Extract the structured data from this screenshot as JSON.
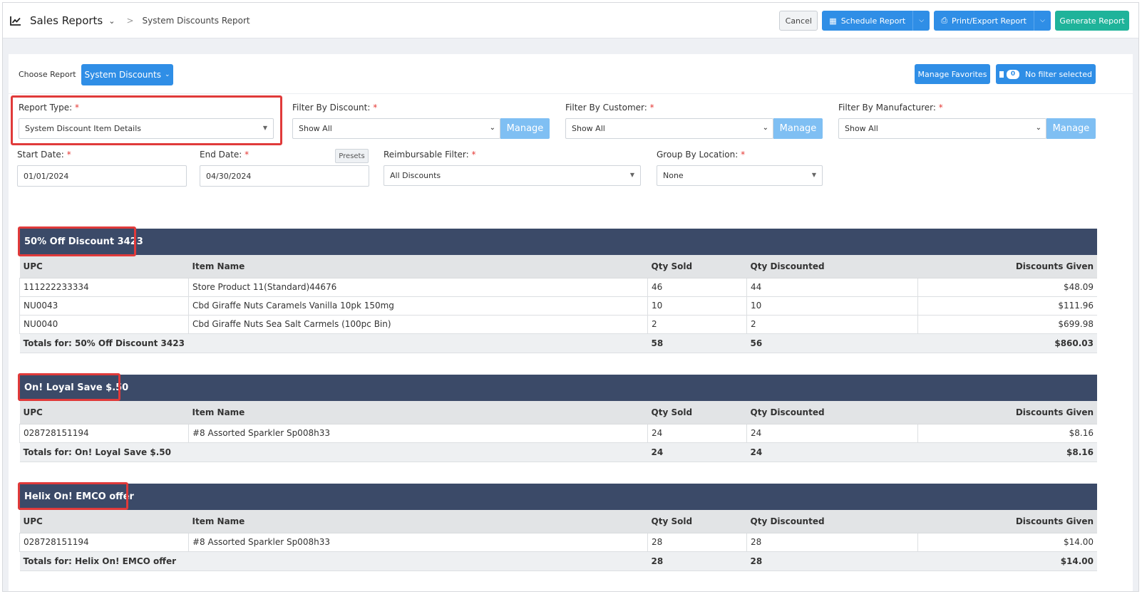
{
  "header": {
    "title": "Sales Reports",
    "breadcrumb": "System Discounts Report",
    "cancel_label": "Cancel",
    "schedule_label": "Schedule Report",
    "print_label": "Print/Export Report",
    "generate_label": "Generate Report"
  },
  "choose": {
    "label": "Choose Report",
    "selected": "System Discounts",
    "manage_favorites": "Manage Favorites",
    "filter_count": "0",
    "filter_text": "No filter selected"
  },
  "filters": {
    "report_type": {
      "label": "Report Type:",
      "value": "System Discount Item Details"
    },
    "discount": {
      "label": "Filter By Discount:",
      "value": "Show All",
      "manage": "Manage"
    },
    "customer": {
      "label": "Filter By Customer:",
      "value": "Show All",
      "manage": "Manage"
    },
    "manufacturer": {
      "label": "Filter By Manufacturer:",
      "value": "Show All",
      "manage": "Manage"
    },
    "start_date": {
      "label": "Start Date:",
      "value": "01/01/2024"
    },
    "end_date": {
      "label": "End Date:",
      "value": "04/30/2024",
      "presets": "Presets"
    },
    "reimbursable": {
      "label": "Reimbursable Filter:",
      "value": "All Discounts"
    },
    "group_by": {
      "label": "Group By Location:",
      "value": "None"
    }
  },
  "columns": [
    "UPC",
    "Item Name",
    "Qty Sold",
    "Qty Discounted",
    "Discounts Given"
  ],
  "groups": [
    {
      "title": "50% Off Discount 3423",
      "rows": [
        [
          "111222233334",
          "Store Product 11(Standard)44676",
          "46",
          "44",
          "$48.09"
        ],
        [
          "NU0043",
          "Cbd Giraffe Nuts Caramels Vanilla 10pk 150mg",
          "10",
          "10",
          "$111.96"
        ],
        [
          "NU0040",
          "Cbd Giraffe Nuts Sea Salt Carmels (100pc Bin)",
          "2",
          "2",
          "$699.98"
        ]
      ],
      "total": [
        "Totals for: 50% Off Discount 3423",
        "58",
        "56",
        "$860.03"
      ]
    },
    {
      "title": "On! Loyal Save $.50",
      "rows": [
        [
          "028728151194",
          "#8 Assorted Sparkler Sp008h33",
          "24",
          "24",
          "$8.16"
        ]
      ],
      "total": [
        "Totals for: On! Loyal Save $.50",
        "24",
        "24",
        "$8.16"
      ]
    },
    {
      "title": "Helix On! EMCO offer",
      "rows": [
        [
          "028728151194",
          "#8 Assorted Sparkler Sp008h33",
          "28",
          "28",
          "$14.00"
        ]
      ],
      "total": [
        "Totals for: Helix On! EMCO offer",
        "28",
        "28",
        "$14.00"
      ]
    }
  ]
}
